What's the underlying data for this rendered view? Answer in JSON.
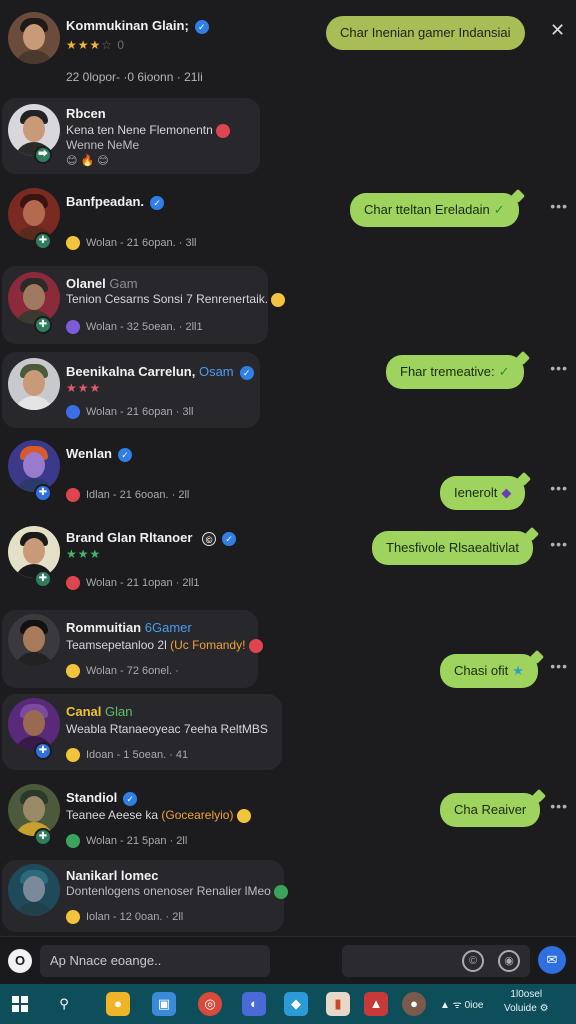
{
  "header": {
    "title": "Kommukinan Glain;",
    "stars": "★★★",
    "stars_tail": "☆ 0",
    "time": "22 0lopor- ·0 6ioonn · 21li",
    "bubble": "Char Inenian gamer Indansiai",
    "close": "✕"
  },
  "rows": [
    {
      "name": "Rbcen",
      "msg": "Kena ten Nene Flemonentn",
      "msg2": "Wenne NeMe",
      "meta": "😊 🔥 😊",
      "reply": ""
    },
    {
      "name": "Banfpeadan.",
      "meta": "Wolan - 21 6opan. · 3ll",
      "reply": "Char tteltan Ereladain"
    },
    {
      "name": "Olanel",
      "name_accent": "Gam",
      "msg": "Tenion Cesarns Sonsi 7 Renrenertaik.",
      "meta": "Wolan - 32 5oean. · 2ll1",
      "reply": ""
    },
    {
      "name": "Beenikalna Carrelun,",
      "name_accent": "Osam",
      "stars": "★★★",
      "meta": "Wolan - 21 6opan · 3ll",
      "reply": "Fhar tremeative:"
    },
    {
      "name": "Wenlan",
      "meta": "Idlan - 21 6ooan. · 2ll",
      "reply": "Ienerolt"
    },
    {
      "name": "Brand Glan Rltanoer",
      "stars": "★★★",
      "meta": "Wolan - 21 1opan · 2ll1",
      "reply": "Thesfivole Rlsaealtivlat"
    },
    {
      "name": "Rommuitian",
      "name_accent": "6Gamer",
      "msg": "Teamsepetanloo 2l",
      "msg_accent": "(Uc Fomandy!",
      "meta": "Wolan - 72 6onel. ·",
      "reply": "Chasi ofit"
    },
    {
      "name": "Canal",
      "name_accent": "Glan",
      "msg": "Weabla Rtanaeoyeac 7eeha ReltMBS",
      "meta": "Idoan - 1 5oean. · 41",
      "reply": ""
    },
    {
      "name": "Standiol",
      "msg": "Teanee Aeese ka",
      "msg_accent": "(Gocearelyio)",
      "meta": "Wolan - 21 5pan · 2ll",
      "reply": "Cha Reaiver"
    },
    {
      "name": "Nanikarl lomec",
      "msg": "Dontenlogens onenoser Renalier lMeo",
      "meta": "Iolan - 12 0oan. · 2ll",
      "reply": ""
    }
  ],
  "more_icon": "•••",
  "composer": {
    "left_icon": "O",
    "placeholder": "Ap Nnace eoange..",
    "send_icon": "✉"
  },
  "taskbar": {
    "tray": "▲ ᯤ 0ioe",
    "clock_line1": "1l0osel",
    "clock_line2": "Voluide ⚙"
  },
  "colors": {
    "bubble": "#9ed35d",
    "header_bubble": "#a8bd55",
    "verified": "#2f7fe6",
    "accent_blue": "#4a9cf0",
    "accent_orange": "#f0a03a",
    "accent_green": "#5cc06a"
  }
}
